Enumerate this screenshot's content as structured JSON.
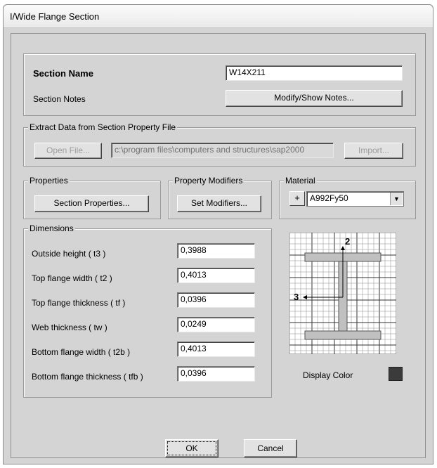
{
  "window": {
    "title": "I/Wide Flange Section"
  },
  "section": {
    "name_label": "Section Name",
    "name_value": "W14X211",
    "notes_label": "Section Notes",
    "notes_button": "Modify/Show Notes..."
  },
  "extract": {
    "legend": "Extract Data from Section Property File",
    "open_button": "Open File...",
    "file_path": "c:\\program files\\computers and structures\\sap2000",
    "import_button": "Import..."
  },
  "properties": {
    "legend": "Properties",
    "button": "Section Properties..."
  },
  "modifiers": {
    "legend": "Property Modifiers",
    "button": "Set Modifiers..."
  },
  "material": {
    "legend": "Material",
    "add_button": "+",
    "selected": "A992Fy50"
  },
  "dimensions": {
    "legend": "Dimensions",
    "rows": [
      {
        "label": "Outside height  ( t3 )",
        "value": "0,3988"
      },
      {
        "label": "Top flange width  ( t2 )",
        "value": "0,4013"
      },
      {
        "label": "Top flange thickness  ( tf )",
        "value": "0,0396"
      },
      {
        "label": "Web thickness  ( tw )",
        "value": "0,0249"
      },
      {
        "label": "Bottom flange width  ( t2b )",
        "value": "0,4013"
      },
      {
        "label": "Bottom flange thickness  ( tfb )",
        "value": "0,0396"
      }
    ]
  },
  "preview": {
    "axis_2": "2",
    "axis_3": "3",
    "section_color": "#c0c0c0",
    "grid_color": "#8a8a8a"
  },
  "display_color": {
    "label": "Display Color",
    "value": "#3b3b3b"
  },
  "footer": {
    "ok_button": "OK",
    "cancel_button": "Cancel"
  }
}
